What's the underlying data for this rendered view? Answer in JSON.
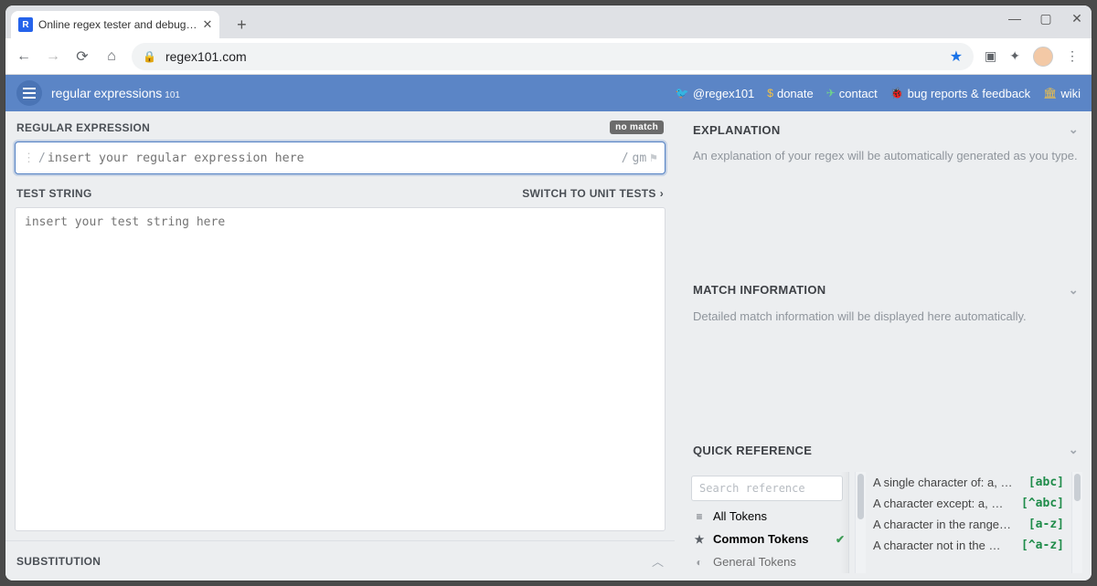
{
  "browser": {
    "tab_title": "Online regex tester and debug…",
    "url": "regex101.com"
  },
  "app_header": {
    "logo1": "regular",
    "logo2": "expressions",
    "logo3": "101",
    "links": {
      "twitter": "@regex101",
      "donate": "donate",
      "contact": "contact",
      "bugs": "bug reports & feedback",
      "wiki": "wiki"
    }
  },
  "left": {
    "regex_title": "REGULAR EXPRESSION",
    "no_match": "no match",
    "regex_placeholder": "insert your regular expression here",
    "regex_flags": "gm",
    "test_title": "TEST STRING",
    "switch_unit": "SWITCH TO UNIT TESTS",
    "test_placeholder": "insert your test string here",
    "substitution_title": "SUBSTITUTION"
  },
  "right": {
    "explanation": {
      "title": "EXPLANATION",
      "body": "An explanation of your regex will be automatically generated as you type."
    },
    "match_info": {
      "title": "MATCH INFORMATION",
      "body": "Detailed match information will be displayed here automatically."
    },
    "quick_ref": {
      "title": "QUICK REFERENCE",
      "search_placeholder": "Search reference",
      "categories": {
        "all": "All Tokens",
        "common": "Common Tokens",
        "general": "General Tokens"
      },
      "items": [
        {
          "text": "A single character of: a, …",
          "tok": "[abc]"
        },
        {
          "text": "A character except: a, …",
          "tok": "[^abc]"
        },
        {
          "text": "A character in the range…",
          "tok": "[a-z]"
        },
        {
          "text": "A character not in the …",
          "tok": "[^a-z]"
        }
      ]
    }
  }
}
